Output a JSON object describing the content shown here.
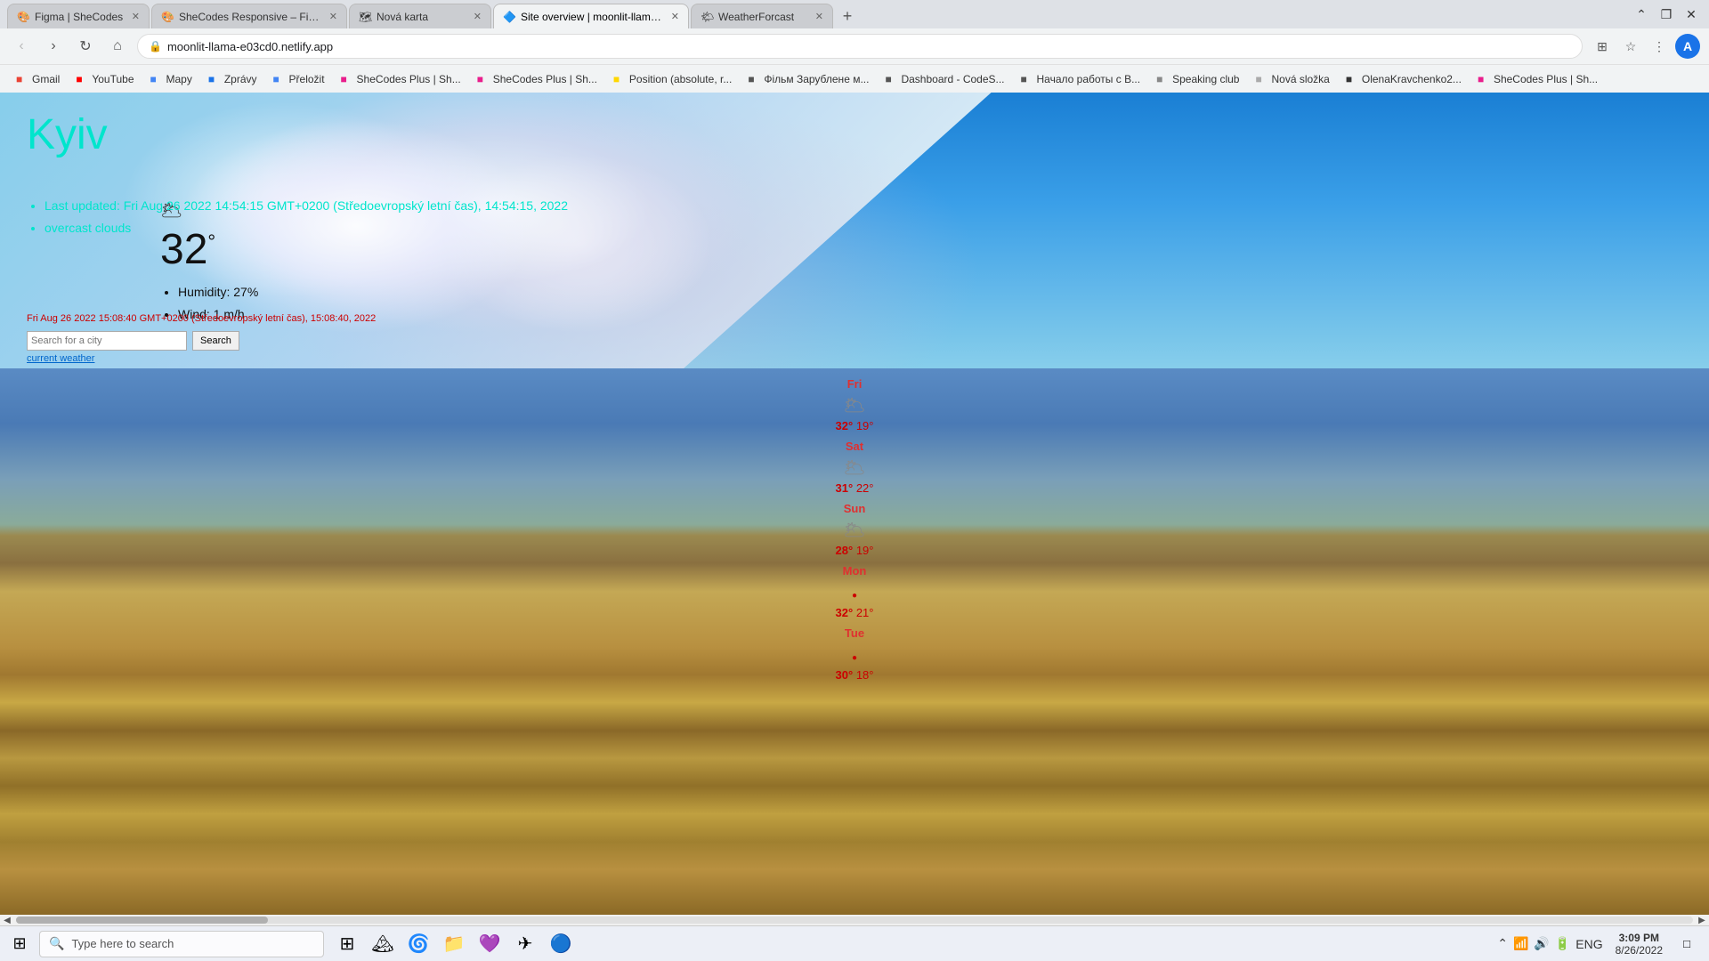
{
  "browser": {
    "tabs": [
      {
        "id": "t1",
        "label": "Figma | SheCodes",
        "active": false,
        "favicon": "🎨"
      },
      {
        "id": "t2",
        "label": "SheCodes Responsive – Figma",
        "active": false,
        "favicon": "🎨"
      },
      {
        "id": "t3",
        "label": "Nová karta",
        "active": false,
        "favicon": "🗺"
      },
      {
        "id": "t4",
        "label": "Site overview | moonlit-llama-e0...",
        "active": true,
        "favicon": "🔷"
      },
      {
        "id": "t5",
        "label": "WeatherForcast",
        "active": false,
        "favicon": "🌤"
      }
    ],
    "url": "moonlit-llama-e03cd0.netlify.app",
    "bookmarks": [
      {
        "label": "Gmail",
        "icon": "fav-gmail"
      },
      {
        "label": "YouTube",
        "icon": "fav-yt"
      },
      {
        "label": "Mapy",
        "icon": "fav-maps"
      },
      {
        "label": "Zprávy",
        "icon": "fav-zpravy"
      },
      {
        "label": "Přeložit",
        "icon": "fav-prelozit"
      },
      {
        "label": "SheCodes Plus | Sh...",
        "icon": "fav-she"
      },
      {
        "label": "SheCodes Plus | Sh...",
        "icon": "fav-she"
      },
      {
        "label": "Position (absolute, r...",
        "icon": "fav-pos"
      },
      {
        "label": "Фільм Зарублене м...",
        "icon": "fav-film"
      },
      {
        "label": "Dashboard - CodeS...",
        "icon": "fav-dash"
      },
      {
        "label": "Начало работы с B...",
        "icon": "fav-dash"
      },
      {
        "label": "Speaking club",
        "icon": "fav-speak"
      },
      {
        "label": "Nová složka",
        "icon": "fav-new"
      },
      {
        "label": "OlenaKravchenko2...",
        "icon": "fav-olena"
      },
      {
        "label": "SheCodes Plus | Sh...",
        "icon": "fav-she2"
      }
    ]
  },
  "weather": {
    "city": "Kyiv",
    "last_updated": "Last updated: Fri Aug 26 2022 14:54:15 GMT+0200 (Středoevropský letní čas), 14:54:15, 2022",
    "condition": "overcast clouds",
    "temperature": "32",
    "temp_unit": "°",
    "humidity_label": "Humidity:",
    "humidity_value": "27%",
    "wind_label": "Wind:",
    "wind_value": "1 m/h",
    "timestamp": "Fri Aug 26 2022 15:08:40 GMT+0200 (Středoevropský letní čas), 15:08:40, 2022",
    "search_placeholder": "Search for a city",
    "search_btn": "Search",
    "current_weather_btn": "current weather",
    "forecast": [
      {
        "day": "Fri",
        "icon": "🌥",
        "high": "32°",
        "low": "19°"
      },
      {
        "day": "Sat",
        "icon": "🌥",
        "high": "31°",
        "low": "22°"
      },
      {
        "day": "Sun",
        "icon": "🌥",
        "high": "28°",
        "low": "19°"
      },
      {
        "day": "Mon",
        "icon": "🔴",
        "high": "32°",
        "low": "21°"
      },
      {
        "day": "Tue",
        "icon": "🔴",
        "high": "30°",
        "low": "18°"
      }
    ]
  },
  "taskbar": {
    "search_placeholder": "Type here to search",
    "apps": [
      {
        "name": "windows-icon",
        "icon": "⊞"
      },
      {
        "name": "photos-app",
        "icon": "🏔"
      },
      {
        "name": "edge-browser",
        "icon": "🌀"
      },
      {
        "name": "file-explorer",
        "icon": "📁"
      },
      {
        "name": "viber-app",
        "icon": "💜"
      },
      {
        "name": "telegram-app",
        "icon": "✈"
      },
      {
        "name": "chrome-browser",
        "icon": "🔵"
      }
    ],
    "tray": {
      "lang": "ENG",
      "time": "3:09 PM",
      "date": "8/26/2022"
    }
  }
}
